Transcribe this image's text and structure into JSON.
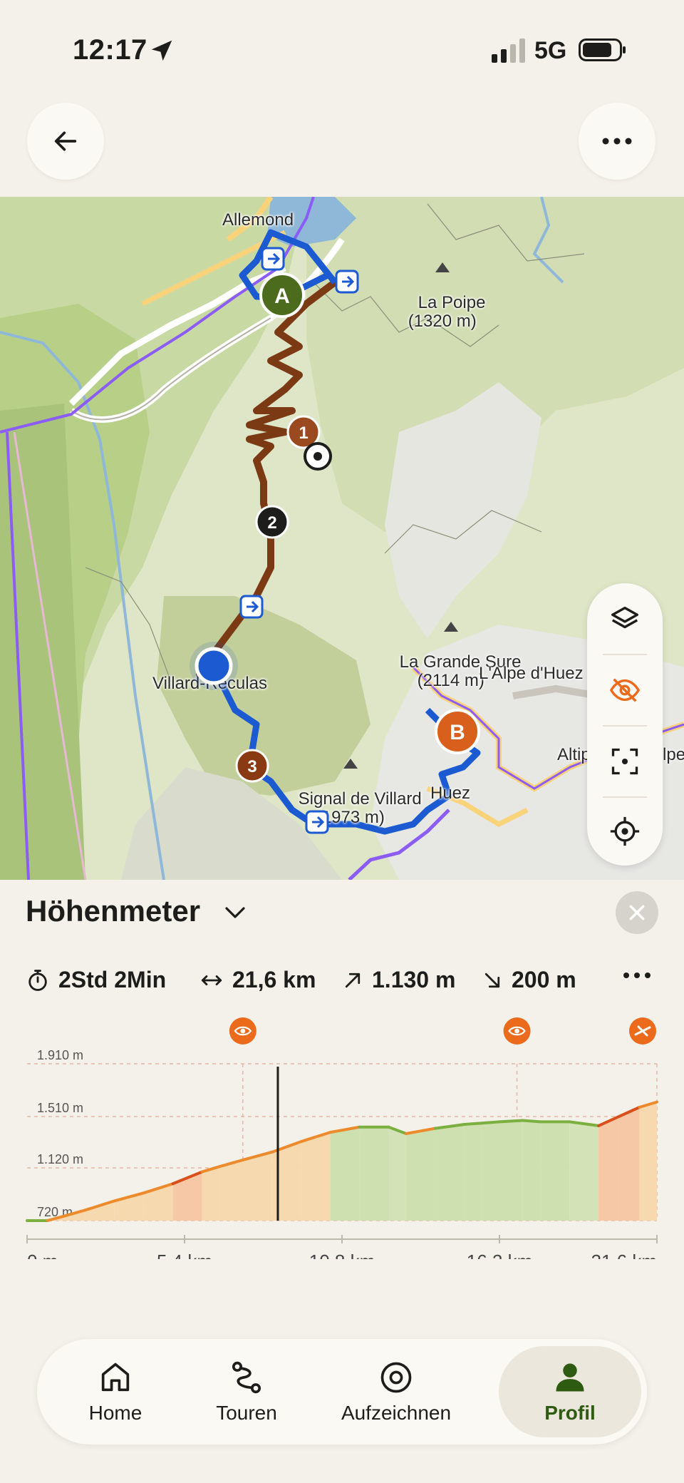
{
  "status_bar": {
    "time": "12:17",
    "network": "5G"
  },
  "header": {
    "back_icon": "arrow-left-icon",
    "more_icon": "ellipsis-icon"
  },
  "map": {
    "labels": {
      "allemond": "Allemond",
      "la_poipe": "La Poipe\n(1320 m)",
      "la_grande_sure": "La Grande Sure\n(2114 m)",
      "alpe_dhuez": "L'Alpe d'Huez",
      "villard_reculas": "Villard-Reculas",
      "signal_de_villard": "Signal de Villard\n(1973 m)",
      "huez": "Huez",
      "altiport": "Altip",
      "alpe2": "Alpe"
    },
    "markers": {
      "start": "A",
      "end": "B",
      "wp1": "1",
      "wp2": "2",
      "wp3": "3"
    },
    "tools": [
      "layers-icon",
      "eye-off-icon",
      "focus-icon",
      "locate-icon"
    ],
    "download_icon": "download-icon",
    "navigate_icon": "navigate-arrow-icon",
    "info_label": "i",
    "colors": {
      "route_brown": "#7b3a14",
      "route_blue": "#1b5ad1",
      "marker_green": "#4c6b1c",
      "marker_orange": "#d95f1c",
      "accent": "#ec6a1c"
    }
  },
  "panel": {
    "title": "Höhenmeter",
    "stats": {
      "duration": "2Std 2Min",
      "distance": "21,6 km",
      "ascent": "1.130 m",
      "descent": "200 m"
    }
  },
  "chart_data": {
    "type": "area",
    "x_unit": "km",
    "x_ticks": [
      "0 m",
      "5,4 km",
      "10,8 km",
      "16,2 km",
      "21,6 km"
    ],
    "y_ticks": [
      "720 m",
      "1.120 m",
      "1.510 m",
      "1.910 m"
    ],
    "y_tick_values": [
      720,
      1120,
      1510,
      1910
    ],
    "ylim": [
      720,
      1910
    ],
    "xlim": [
      0,
      21.6
    ],
    "x": [
      0,
      0.7,
      1.2,
      2.0,
      3.0,
      4.0,
      5.0,
      6.0,
      6.6,
      7.4,
      8.4,
      9.4,
      10.4,
      11.4,
      12.4,
      13.0,
      14.0,
      15.0,
      15.6,
      16.2,
      17.0,
      17.6,
      18.6,
      19.6,
      20.3,
      21.0,
      21.6
    ],
    "y": [
      720,
      720,
      750,
      800,
      870,
      930,
      1000,
      1090,
      1130,
      1180,
      1240,
      1320,
      1390,
      1430,
      1430,
      1380,
      1420,
      1450,
      1460,
      1470,
      1480,
      1470,
      1470,
      1440,
      1510,
      1580,
      1620
    ],
    "cursor_x": 8.6,
    "markers": [
      {
        "x": 7.4,
        "icon": "eye-icon"
      },
      {
        "x": 16.8,
        "icon": "eye-icon"
      },
      {
        "x": 21.6,
        "icon": "road-icon"
      }
    ],
    "grid": true
  },
  "tabbar": {
    "tabs": [
      {
        "label": "Home",
        "icon": "home-icon"
      },
      {
        "label": "Touren",
        "icon": "route-icon"
      },
      {
        "label": "Aufzeichnen",
        "icon": "record-icon"
      },
      {
        "label": "Profil",
        "icon": "profile-icon"
      }
    ],
    "active_index": 3
  }
}
